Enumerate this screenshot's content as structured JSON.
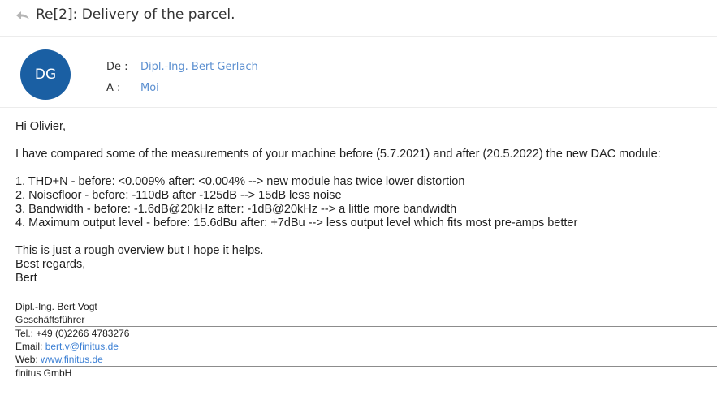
{
  "subject": "Re[2]: Delivery of the parcel.",
  "sender": {
    "avatar_initials": "DG",
    "avatar_color": "#1a5fa3",
    "from_label": "De :",
    "from_name": "Dipl.-Ing. Bert Gerlach",
    "to_label": "A :",
    "to_name": "Moi"
  },
  "body": {
    "greeting": "Hi Olivier,",
    "intro": "I have compared some of the measurements of your machine before (5.7.2021) and after (20.5.2022) the new DAC module:",
    "items": [
      "1. THD+N  - before: <0.009% after: <0.004% --> new module has twice lower distortion",
      "2. Noisefloor - before: -110dB after -125dB --> 15dB less noise",
      "3. Bandwidth - before: -1.6dB@20kHz after: -1dB@20kHz --> a little more bandwidth",
      "4. Maximum output level - before: 15.6dBu after: +7dBu --> less output level which fits most pre-amps better"
    ],
    "closing": [
      "This is just a rough overview but I hope it helps.",
      "Best regards,",
      "Bert"
    ]
  },
  "signature": {
    "name": "Dipl.-Ing. Bert Vogt",
    "role": "Geschäftsführer",
    "tel": "Tel.: +49 (0)2266 4783276",
    "email_label": "Email: ",
    "email": "bert.v@finitus.de",
    "web_label": "Web: ",
    "web": "www.finitus.de",
    "company": "finitus GmbH"
  }
}
